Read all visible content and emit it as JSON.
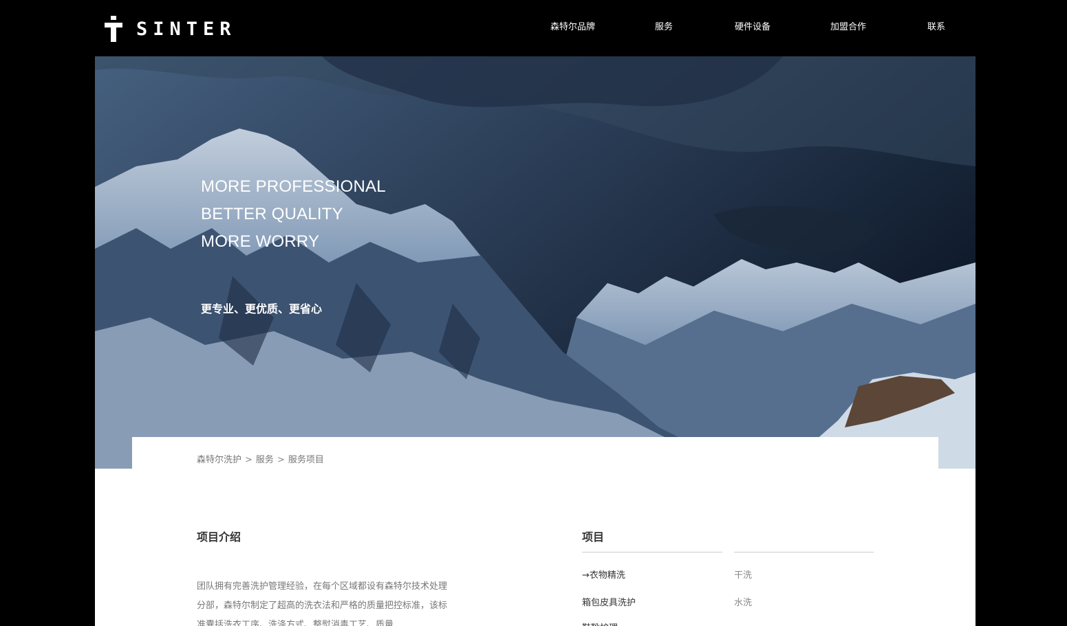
{
  "brand": {
    "name": "SINTER"
  },
  "nav": {
    "items": [
      {
        "label": "森特尔品牌"
      },
      {
        "label": "服务"
      },
      {
        "label": "硬件设备"
      },
      {
        "label": "加盟合作"
      },
      {
        "label": "联系"
      }
    ]
  },
  "hero": {
    "lines": [
      "MORE PROFESSIONAL",
      "BETTER QUALITY",
      "MORE WORRY"
    ],
    "subtitle": "更专业、更优质、更省心"
  },
  "breadcrumb": {
    "items": [
      "森特尔洗护",
      "服务",
      "服务项目"
    ],
    "separator": ">"
  },
  "intro": {
    "title": "项目介绍",
    "body": "团队拥有完善洗护管理经验，在每个区域都设有森特尔技术处理分部，森特尔制定了超高的洗衣法和严格的质量把控标准，该标准囊括洗衣工序、洗涤方式、整熨消毒工艺、质量"
  },
  "projects": {
    "title": "项目",
    "left_items": [
      "→衣物精洗",
      "箱包皮具洗护",
      "鞋靴护理"
    ],
    "right_items": [
      "干洗",
      "水洗"
    ]
  },
  "colors": {
    "header_bg": "#000000",
    "hero_sky": "#2c3d55",
    "text_dark": "#333333",
    "text_muted": "#777777"
  }
}
